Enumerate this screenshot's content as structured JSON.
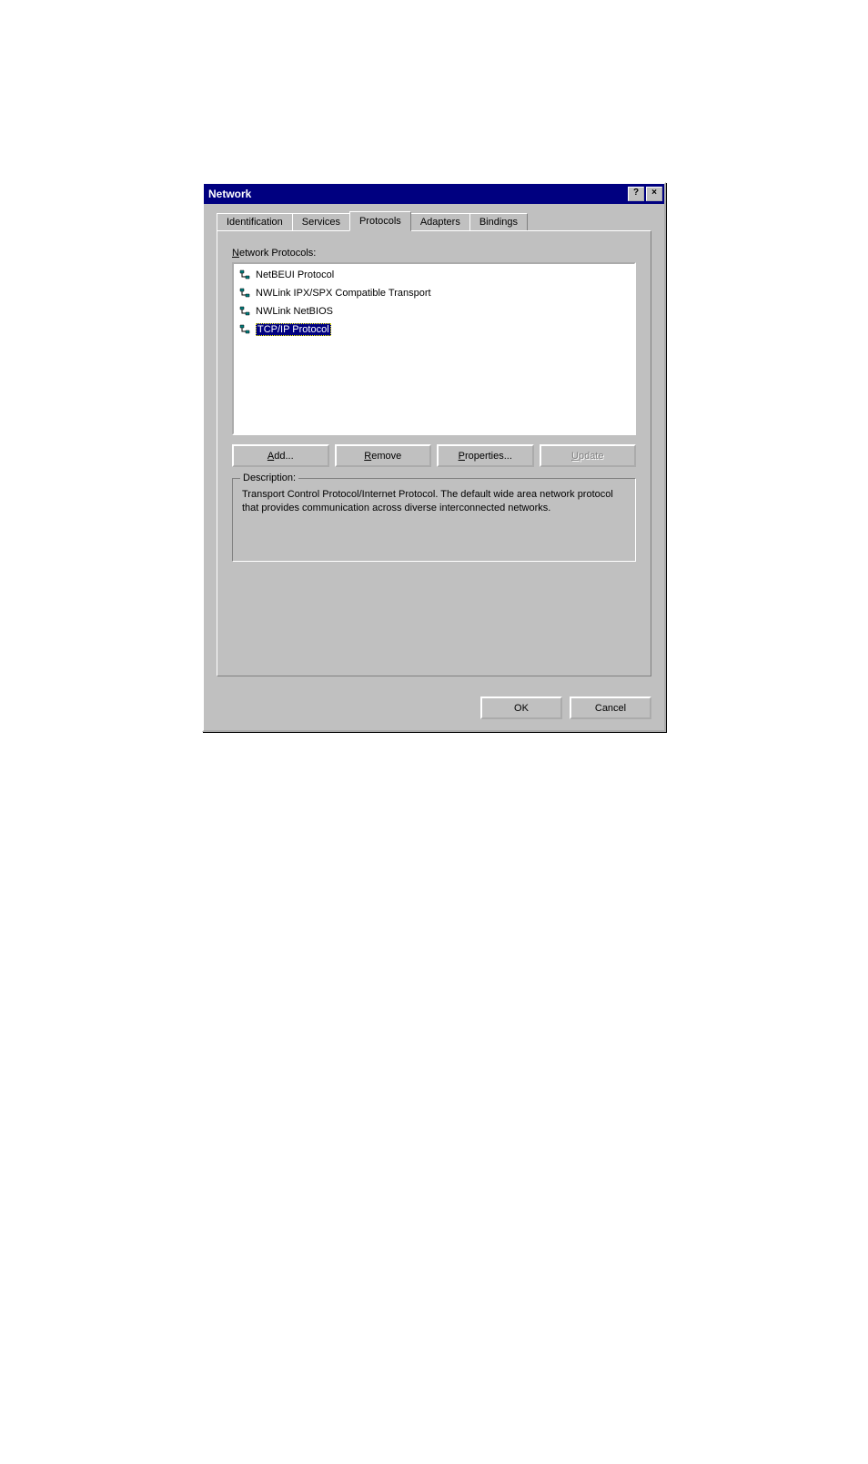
{
  "titlebar": {
    "title": "Network",
    "help": "?",
    "close": "×"
  },
  "tabs": {
    "identification": "Identification",
    "services": "Services",
    "protocols": "Protocols",
    "adapters": "Adapters",
    "bindings": "Bindings"
  },
  "panel": {
    "list_label_prefix": "N",
    "list_label_rest": "etwork Protocols:",
    "items": [
      {
        "label": "NetBEUI Protocol",
        "selected": false
      },
      {
        "label": "NWLink IPX/SPX Compatible Transport",
        "selected": false
      },
      {
        "label": "NWLink NetBIOS",
        "selected": false
      },
      {
        "label": "TCP/IP Protocol",
        "selected": true
      }
    ],
    "buttons": {
      "add_u": "A",
      "add_rest": "dd...",
      "remove_u": "R",
      "remove_rest": "emove",
      "properties_u": "P",
      "properties_rest": "roperties...",
      "update_u": "U",
      "update_rest": "pdate"
    },
    "description_label": "Description:",
    "description_text": "Transport Control Protocol/Internet Protocol. The default wide area network protocol that provides communication across diverse interconnected networks."
  },
  "footer": {
    "ok": "OK",
    "cancel": "Cancel"
  }
}
